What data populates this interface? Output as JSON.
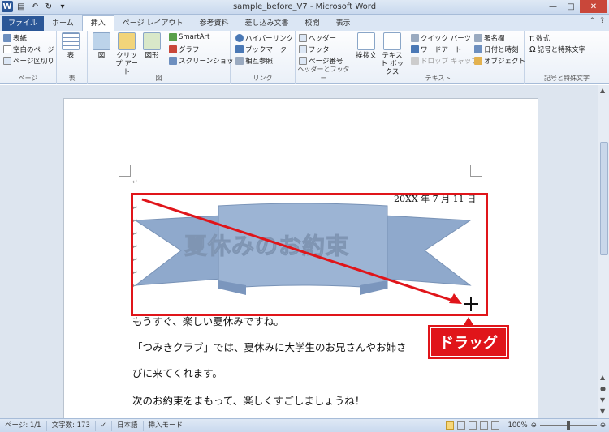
{
  "window": {
    "title": "sample_before_V7 - Microsoft Word",
    "app_icon": "W"
  },
  "tabs": [
    "ファイル",
    "ホーム",
    "挿入",
    "ページ レイアウト",
    "参考資料",
    "差し込み文書",
    "校閲",
    "表示"
  ],
  "ribbon": {
    "pages": {
      "label": "ページ",
      "items": [
        "表紙",
        "空白のページ",
        "ページ区切り"
      ]
    },
    "table": {
      "label": "表",
      "button": "表"
    },
    "illust": {
      "label": "図",
      "buttons": [
        "図",
        "クリップ アート",
        "図形"
      ],
      "items": [
        "SmartArt",
        "グラフ",
        "スクリーンショット"
      ]
    },
    "links": {
      "label": "リンク",
      "items": [
        "ハイパーリンク",
        "ブックマーク",
        "相互参照"
      ]
    },
    "header_footer": {
      "label": "ヘッダーとフッター",
      "items": [
        "ヘッダー",
        "フッター",
        "ページ番号"
      ]
    },
    "text": {
      "label": "テキスト",
      "buttons": [
        "挨拶文",
        "テキスト ボックス"
      ],
      "items": [
        "クイック パーツ",
        "ワードアート",
        "ドロップ キャップ",
        "署名欄",
        "日付と時刻",
        "オブジェクト"
      ]
    },
    "symbols": {
      "label": "記号と特殊文字",
      "items": [
        "数式",
        "記号と特殊文字"
      ]
    }
  },
  "document": {
    "date_line": "20XX 年 7 月 11 日",
    "wordart_text": "夏休みのお約束",
    "lines": [
      "もうすぐ、楽しい夏休みですね。",
      "「つみきクラブ」では、夏休みに大学生のお兄さんやお姉さ",
      "びに来てくれます。",
      "次のお約束をまもって、楽しくすごしましょうね！"
    ]
  },
  "annotation": {
    "callout": "ドラッグ"
  },
  "status": {
    "page": "ページ: 1/1",
    "words": "文字数: 173",
    "lang": "日本語",
    "mode": "挿入モード",
    "zoom": "100%"
  },
  "colors": {
    "accent_red": "#e0151a",
    "wordart_fill": "#8fa9cc",
    "file_tab": "#2b5797"
  }
}
